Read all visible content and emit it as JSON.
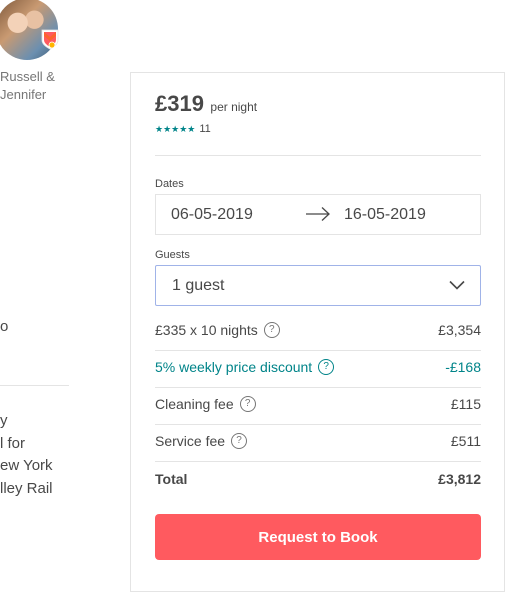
{
  "host": {
    "name": "Russell &\nJennifer",
    "avatar_icon": "host-avatar",
    "badge_icon": "superhost-badge-icon"
  },
  "left_fragments": {
    "line_o": "o",
    "lines": "y\nl for\new York\nlley Rail"
  },
  "booking": {
    "price": "£319",
    "per_night": "per night",
    "stars": "★★★★★",
    "review_count": "11",
    "dates_label": "Dates",
    "check_in": "06-05-2019",
    "check_out": "16-05-2019",
    "guests_label": "Guests",
    "guests_value": "1 guest",
    "lines": [
      {
        "label": "£335 x 10 nights",
        "amount": "£3,354",
        "help": "?"
      },
      {
        "label": "5% weekly price discount",
        "amount": "-£168",
        "help": "?",
        "accent": "#008489"
      },
      {
        "label": "Cleaning fee",
        "amount": "£115",
        "help": "?"
      },
      {
        "label": "Service fee",
        "amount": "£511",
        "help": "?"
      }
    ],
    "total_label": "Total",
    "total_amount": "£3,812",
    "request_button": "Request to Book"
  },
  "colors": {
    "accent": "#ff5a5f",
    "teal": "#008489",
    "text": "#484848"
  }
}
